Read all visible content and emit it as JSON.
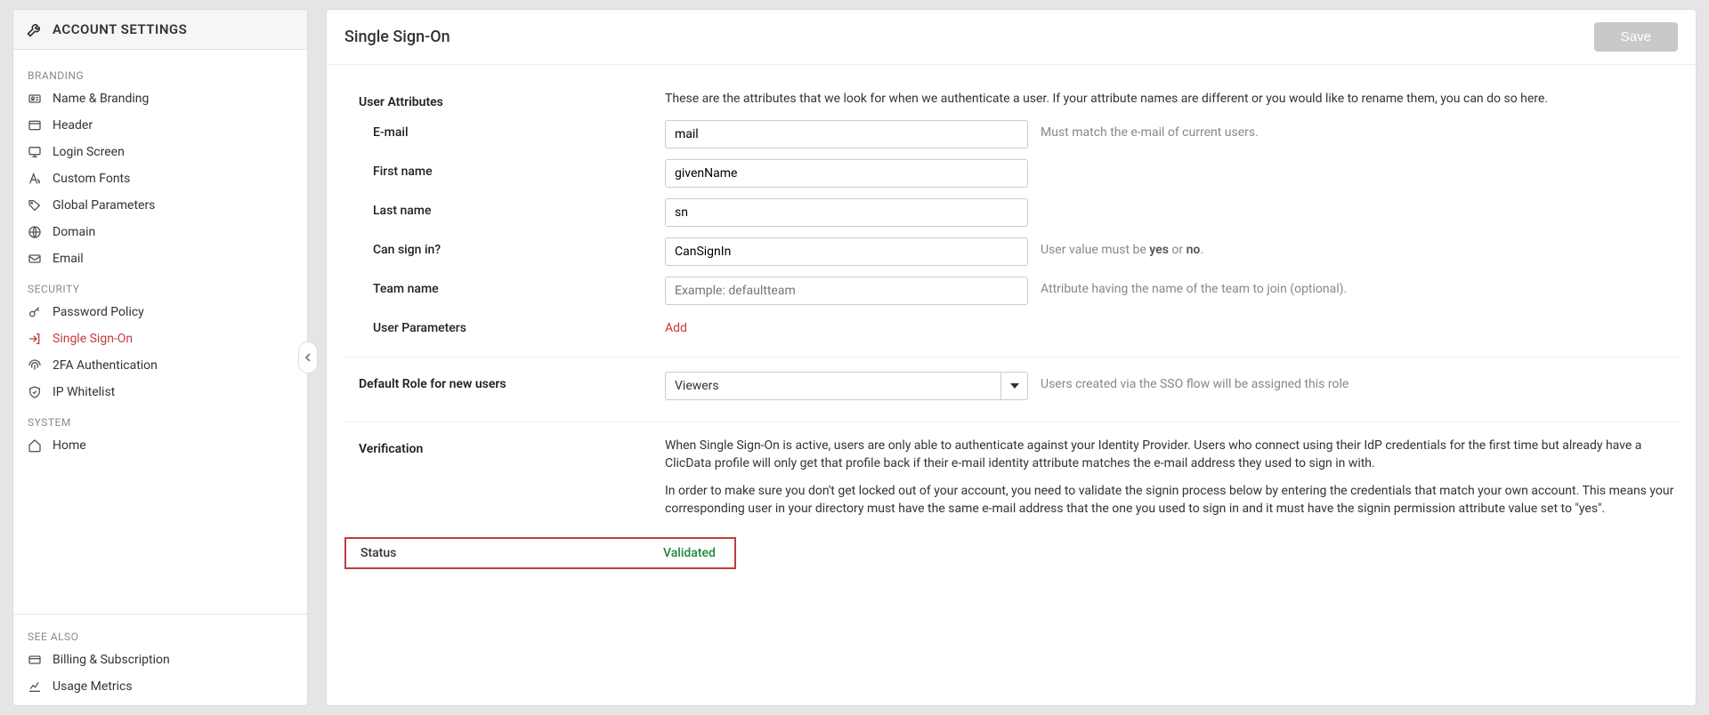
{
  "sidebar": {
    "title": "ACCOUNT SETTINGS",
    "groups": [
      {
        "header": "BRANDING",
        "items": [
          {
            "label": "Name & Branding",
            "icon": "id-card"
          },
          {
            "label": "Header",
            "icon": "window"
          },
          {
            "label": "Login Screen",
            "icon": "monitor"
          },
          {
            "label": "Custom Fonts",
            "icon": "font"
          },
          {
            "label": "Global Parameters",
            "icon": "tag"
          },
          {
            "label": "Domain",
            "icon": "globe"
          },
          {
            "label": "Email",
            "icon": "mail"
          }
        ]
      },
      {
        "header": "SECURITY",
        "items": [
          {
            "label": "Password Policy",
            "icon": "key"
          },
          {
            "label": "Single Sign-On",
            "icon": "login",
            "active": true
          },
          {
            "label": "2FA Authentication",
            "icon": "fingerprint"
          },
          {
            "label": "IP Whitelist",
            "icon": "shield"
          }
        ]
      },
      {
        "header": "SYSTEM",
        "items": [
          {
            "label": "Home",
            "icon": "home"
          }
        ]
      }
    ],
    "footer": {
      "header": "SEE ALSO",
      "items": [
        {
          "label": "Billing & Subscription",
          "icon": "card"
        },
        {
          "label": "Usage Metrics",
          "icon": "chartline"
        }
      ]
    }
  },
  "main": {
    "title": "Single Sign-On",
    "save_label": "Save",
    "user_attributes": {
      "heading": "User Attributes",
      "description": "These are the attributes that we look for when we authenticate a user. If your attribute names are different or you would like to rename them, you can do so here.",
      "email_label": "E-mail",
      "email_value": "mail",
      "email_help": "Must match the e-mail of current users.",
      "firstname_label": "First name",
      "firstname_value": "givenName",
      "lastname_label": "Last name",
      "lastname_value": "sn",
      "cansignin_label": "Can sign in?",
      "cansignin_value": "CanSignIn",
      "cansignin_help_pre": "User value must be ",
      "cansignin_help_yes": "yes",
      "cansignin_help_or": " or ",
      "cansignin_help_no": "no",
      "cansignin_help_post": ".",
      "teamname_label": "Team name",
      "teamname_placeholder": "Example: defaultteam",
      "teamname_help": "Attribute having the name of the team to join (optional).",
      "userparams_label": "User Parameters",
      "userparams_add": "Add"
    },
    "defaultrole": {
      "label": "Default Role for new users",
      "value": "Viewers",
      "help": "Users created via the SSO flow will be assigned this role"
    },
    "verification": {
      "label": "Verification",
      "para1": "When Single Sign-On is active, users are only able to authenticate against your Identity Provider. Users who connect using their IdP credentials for the first time but already have a ClicData profile will only get that profile back if their e-mail identity attribute matches the e-mail address they used to sign in with.",
      "para2": "In order to make sure you don't get locked out of your account, you need to validate the signin process below by entering the credentials that match your own account. This means your corresponding user in your directory must have the same e-mail address that the one you used to sign in and it must have the signin permission attribute value set to \"yes\"."
    },
    "status": {
      "label": "Status",
      "value": "Validated"
    }
  }
}
